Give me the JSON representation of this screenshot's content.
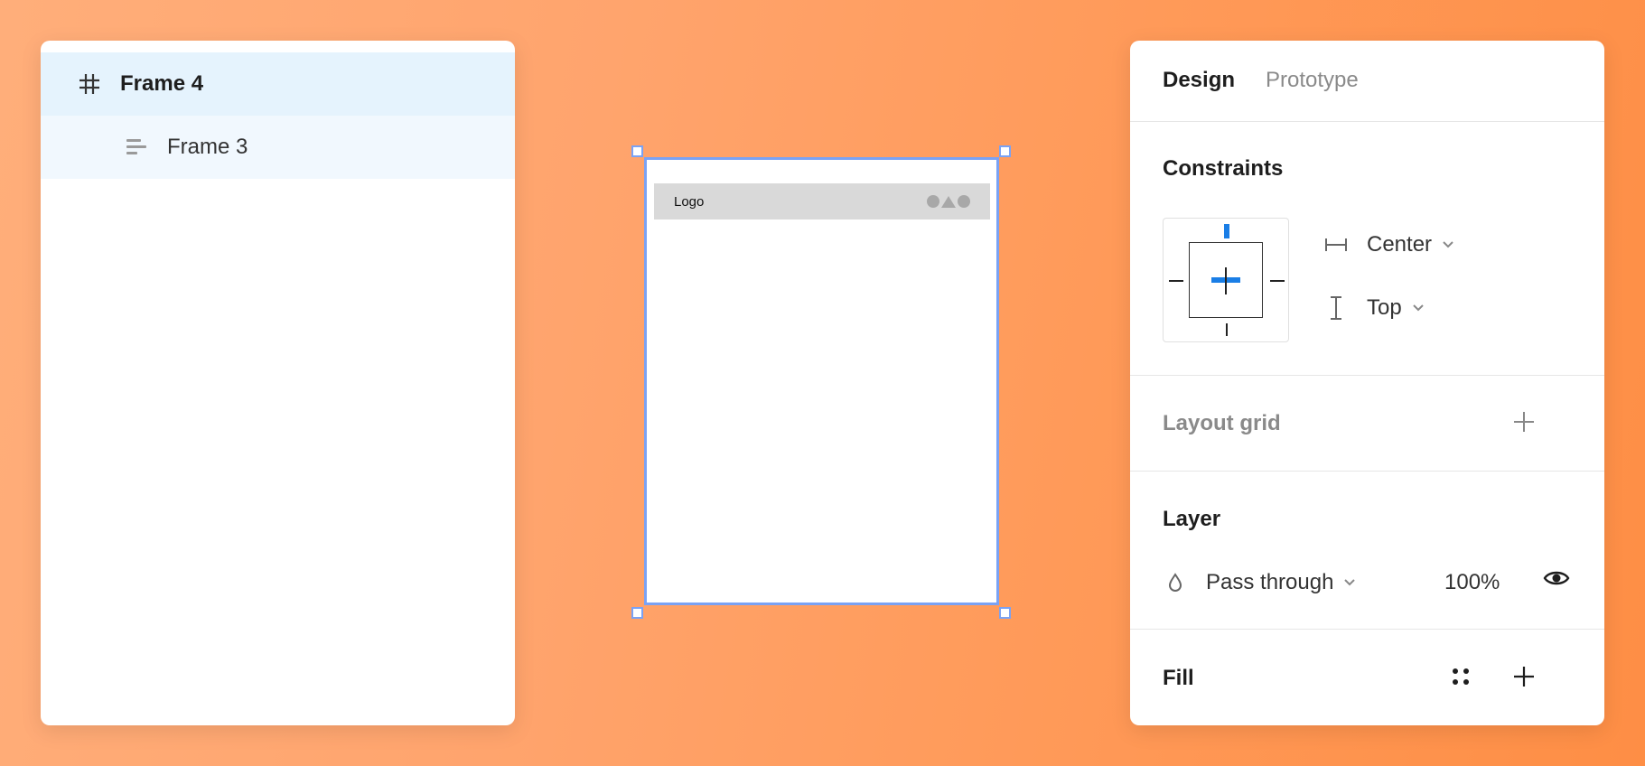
{
  "layers": {
    "items": [
      {
        "label": "Frame 4",
        "icon": "frame-hash-icon",
        "selected": true
      },
      {
        "label": "Frame 3",
        "icon": "auto-layout-icon",
        "selected": false
      }
    ]
  },
  "canvas": {
    "nav_logo": "Logo",
    "nav_icons": [
      "circle-icon",
      "triangle-icon",
      "circle-icon"
    ]
  },
  "design_panel": {
    "tabs": {
      "design": "Design",
      "prototype": "Prototype"
    },
    "constraints": {
      "title": "Constraints",
      "horizontal": "Center",
      "vertical": "Top"
    },
    "layout_grid": {
      "title": "Layout grid"
    },
    "layer": {
      "title": "Layer",
      "blend_mode": "Pass through",
      "opacity": "100%"
    },
    "fill": {
      "title": "Fill"
    }
  },
  "colors": {
    "background_start": "#ffae7a",
    "background_end": "#fe8e45",
    "selection": "#7aa2f4",
    "constraint_accent": "#1a7ee6",
    "layer_selected_bg": "#e5f3fd"
  }
}
